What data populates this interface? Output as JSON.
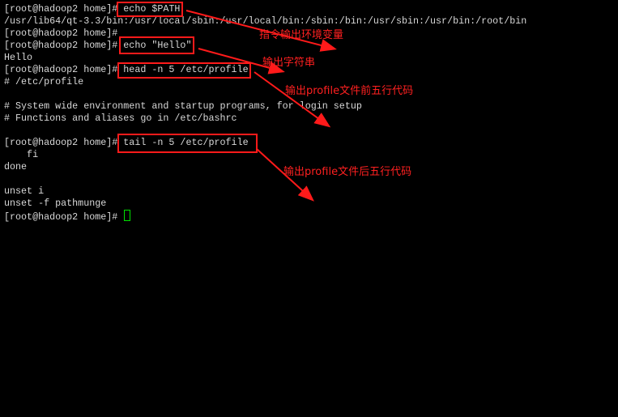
{
  "terminal": {
    "lines": [
      {
        "prompt": "[root@hadoop2 home]# ",
        "text": "echo $PATH"
      },
      {
        "prompt": "",
        "text": "/usr/lib64/qt-3.3/bin:/usr/local/sbin:/usr/local/bin:/sbin:/bin:/usr/sbin:/usr/bin:/root/bin"
      },
      {
        "prompt": "[root@hadoop2 home]#",
        "text": ""
      },
      {
        "prompt": "[root@hadoop2 home]# ",
        "text": "echo \"Hello\""
      },
      {
        "prompt": "",
        "text": "Hello"
      },
      {
        "prompt": "[root@hadoop2 home]# ",
        "text": "head -n 5 /etc/profile"
      },
      {
        "prompt": "",
        "text": "# /etc/profile"
      },
      {
        "prompt": "",
        "text": ""
      },
      {
        "prompt": "",
        "text": "# System wide environment and startup programs, for login setup"
      },
      {
        "prompt": "",
        "text": "# Functions and aliases go in /etc/bashrc"
      },
      {
        "prompt": "",
        "text": ""
      },
      {
        "prompt": "[root@hadoop2 home]# ",
        "text": "tail -n 5 /etc/profile"
      },
      {
        "prompt": "",
        "text": "    fi"
      },
      {
        "prompt": "",
        "text": "done"
      },
      {
        "prompt": "",
        "text": ""
      },
      {
        "prompt": "",
        "text": "unset i"
      },
      {
        "prompt": "",
        "text": "unset -f pathmunge"
      },
      {
        "prompt": "[root@hadoop2 home]# ",
        "text": ""
      }
    ],
    "cursor_color": "#00e000"
  },
  "annotations": [
    {
      "label": "指令输出环境变量"
    },
    {
      "label": "输出字符串"
    },
    {
      "label": "输出profile文件前五行代码"
    },
    {
      "label": "输出profile文件后五行代码"
    }
  ],
  "annotation_color": "#ff2020"
}
